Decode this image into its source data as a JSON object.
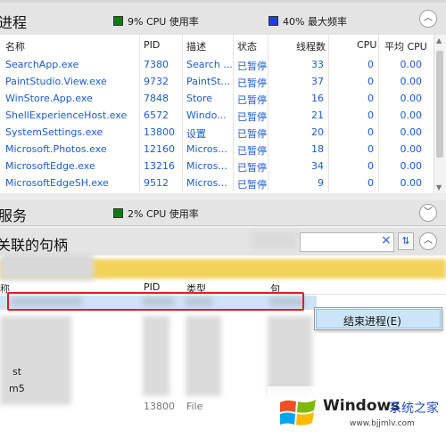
{
  "process_section": {
    "title": "进程",
    "cpu_label": "9% CPU 使用率",
    "freq_label": "40% 最大频率",
    "cpu_color": "#0f7c10",
    "freq_color": "#1f3fd8"
  },
  "columns": [
    "名称",
    "PID",
    "描述",
    "状态",
    "线程数",
    "CPU",
    "平均 CPU"
  ],
  "rows": [
    {
      "name": "SearchApp.exe",
      "pid": "7380",
      "desc": "Search ...",
      "status": "已暂停",
      "threads": "33",
      "cpu": "0",
      "avg": "0.00"
    },
    {
      "name": "PaintStudio.View.exe",
      "pid": "9732",
      "desc": "PaintSt...",
      "status": "已暂停",
      "threads": "37",
      "cpu": "0",
      "avg": "0.00"
    },
    {
      "name": "WinStore.App.exe",
      "pid": "7848",
      "desc": "Store",
      "status": "已暂停",
      "threads": "16",
      "cpu": "0",
      "avg": "0.00"
    },
    {
      "name": "ShellExperienceHost.exe",
      "pid": "6572",
      "desc": "Windo...",
      "status": "已暂停",
      "threads": "21",
      "cpu": "0",
      "avg": "0.00"
    },
    {
      "name": "SystemSettings.exe",
      "pid": "13800",
      "desc": "设置",
      "status": "已暂停",
      "threads": "20",
      "cpu": "0",
      "avg": "0.00"
    },
    {
      "name": "Microsoft.Photos.exe",
      "pid": "12160",
      "desc": "Micros...",
      "status": "已暂停",
      "threads": "18",
      "cpu": "0",
      "avg": "0.00"
    },
    {
      "name": "MicrosoftEdge.exe",
      "pid": "13216",
      "desc": "Micros...",
      "status": "已暂停",
      "threads": "34",
      "cpu": "0",
      "avg": "0.00"
    },
    {
      "name": "MicrosoftEdgeSH.exe",
      "pid": "9512",
      "desc": "Micros...",
      "status": "已暂停",
      "threads": "9",
      "cpu": "0",
      "avg": "0.00"
    }
  ],
  "service_section": {
    "title": "服务",
    "cpu_label": "2% CPU 使用率"
  },
  "handles_section": {
    "title": "关联的句柄",
    "search_clear": "×",
    "col_name": "称",
    "col_pid": "PID",
    "col_type": "类型",
    "col_handle": "句",
    "partial_1": "st",
    "partial_2": "m5",
    "partial_pid": "13800",
    "partial_type": "File"
  },
  "context_menu": {
    "end_process": "结束进程(E)"
  },
  "watermark": {
    "title": "Windows",
    "subtitle": "系统之家",
    "url": "www.bjjmlv.com"
  }
}
